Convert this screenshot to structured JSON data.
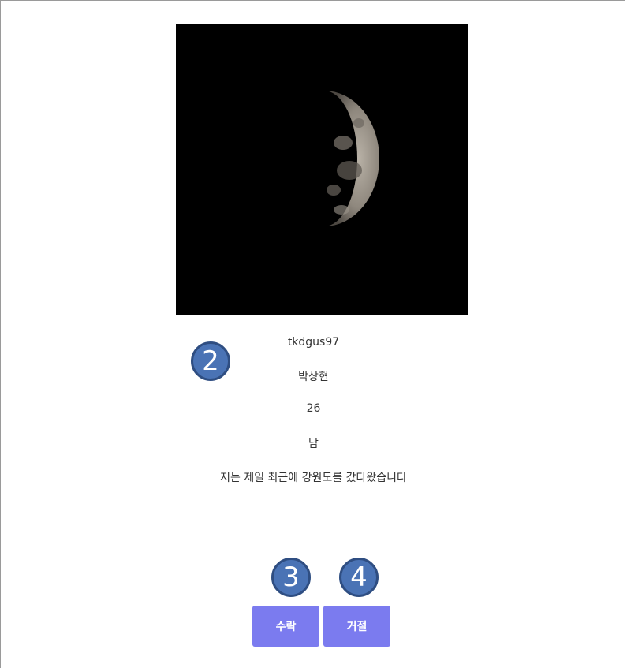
{
  "profile": {
    "username": "tkdgus97",
    "name": "박상현",
    "age": "26",
    "gender": "남",
    "bio": "저는 제일 최근에 강원도를 갔다왔습니다",
    "photo_alt": "half moon photo"
  },
  "callouts": {
    "two": "2",
    "three": "3",
    "four": "4"
  },
  "actions": {
    "accept_label": "수락",
    "reject_label": "거절"
  },
  "colors": {
    "button": "#7b7bef",
    "callout": "#4a73b5",
    "photo_bg": "#000000"
  }
}
